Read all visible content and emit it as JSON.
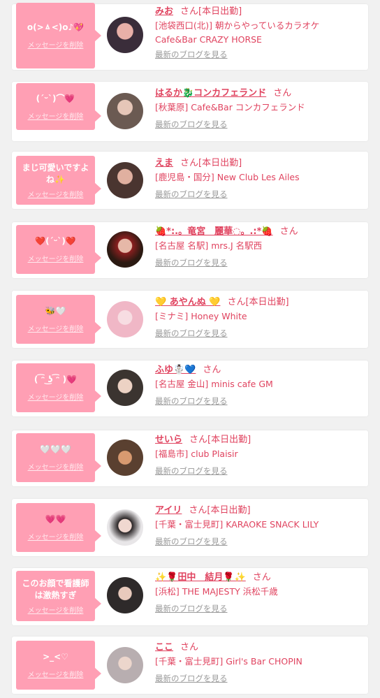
{
  "ui": {
    "delete_label": "メッセージを削除",
    "blog_label": "最新のブログを見る",
    "san": "さん"
  },
  "cards": [
    {
      "message": "o(>ㅿ<)o♪💖",
      "name": "みお",
      "status": "[本日出勤]",
      "shop": "[池袋西口(北)] 朝からやっているカラオケ",
      "shop2": "Cafe&Bar CRAZY HORSE",
      "avatar_color": "#3a2d3a"
    },
    {
      "message": "(ˊᵕˋ)⌒💗",
      "name": "はるか🐉コンカフェランド",
      "status": "",
      "shop": "[秋葉原] Cafe&Bar コンカフェランド",
      "shop2": "",
      "avatar_color": "#6b5a52"
    },
    {
      "message": "まじ可愛いですよね✨",
      "name": "えま",
      "status": "[本日出勤]",
      "shop": "[鹿児島・国分] New Club Les Ailes",
      "shop2": "",
      "avatar_color": "#4a3530"
    },
    {
      "message": "❤️(ˊᵕˋ)❤️",
      "name": "🍓*:.。竜宮　麗華◌。.:*🍓",
      "status": "",
      "shop": "[名古屋 名駅] mrs.J 名駅西",
      "shop2": "",
      "avatar_color": "#7a2a25"
    },
    {
      "message": "🐝🤍",
      "name": "💛 あやんぬ 💛",
      "status": "[本日出勤]",
      "shop": "[ミナミ] Honey White",
      "shop2": "",
      "avatar_color": "#f2c2cf"
    },
    {
      "message": "( ͡ᵔ ͜ʖ ͡ᵔ )💗",
      "name": "ふゆ☃️💙",
      "status": "",
      "shop": "[名古屋 金山] minis cafe GM",
      "shop2": "",
      "avatar_color": "#3b3430"
    },
    {
      "message": "🤍🤍🤍",
      "name": "せいら",
      "status": "[本日出勤]",
      "shop": "[福島市] club Plaisir",
      "shop2": "",
      "avatar_color": "#5a4030"
    },
    {
      "message": "💗💗",
      "name": "アイリ",
      "status": "[本日出勤]",
      "shop": "[千葉・富士見町] KARAOKE SNACK LILY",
      "shop2": "",
      "avatar_color": "#d8d4d6"
    },
    {
      "message": "このお顔で看護師は激熱すぎ",
      "name": "✨🌹田中　結月🌹✨",
      "status": "",
      "shop": "[浜松] THE MAJESTY 浜松千歳",
      "shop2": "",
      "avatar_color": "#2e2a2a"
    },
    {
      "message": ">_<♡",
      "name": "ここ",
      "status": "",
      "shop": "[千葉・富士見町] Girl's Bar CHOPIN",
      "shop2": "",
      "avatar_color": "#b8aeb0"
    }
  ]
}
